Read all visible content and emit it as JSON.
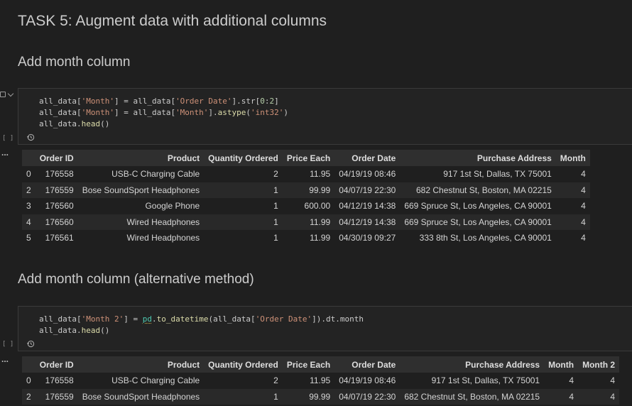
{
  "headings": {
    "task": "TASK 5: Augment data with additional columns",
    "section1": "Add month column",
    "section2": "Add month column (alternative method)"
  },
  "cells": [
    {
      "exec_count": "[ ]",
      "code_lines": [
        "all_data['Month'] = all_data['Order Date'].str[0:2]",
        "all_data['Month'] = all_data['Month'].astype('int32')",
        "all_data.head()"
      ]
    },
    {
      "exec_count": "[ ]",
      "code_lines": [
        "all_data['Month 2'] = pd.to_datetime(all_data['Order Date']).dt.month",
        "all_data.head()"
      ]
    }
  ],
  "output_marker": "...",
  "table1": {
    "columns": [
      "",
      "Order ID",
      "Product",
      "Quantity Ordered",
      "Price Each",
      "Order Date",
      "Purchase Address",
      "Month"
    ],
    "rows": [
      [
        "0",
        "176558",
        "USB-C Charging Cable",
        "2",
        "11.95",
        "04/19/19 08:46",
        "917 1st St, Dallas, TX 75001",
        "4"
      ],
      [
        "2",
        "176559",
        "Bose SoundSport Headphones",
        "1",
        "99.99",
        "04/07/19 22:30",
        "682 Chestnut St, Boston, MA 02215",
        "4"
      ],
      [
        "3",
        "176560",
        "Google Phone",
        "1",
        "600.00",
        "04/12/19 14:38",
        "669 Spruce St, Los Angeles, CA 90001",
        "4"
      ],
      [
        "4",
        "176560",
        "Wired Headphones",
        "1",
        "11.99",
        "04/12/19 14:38",
        "669 Spruce St, Los Angeles, CA 90001",
        "4"
      ],
      [
        "5",
        "176561",
        "Wired Headphones",
        "1",
        "11.99",
        "04/30/19 09:27",
        "333 8th St, Los Angeles, CA 90001",
        "4"
      ]
    ]
  },
  "table2": {
    "columns": [
      "",
      "Order ID",
      "Product",
      "Quantity Ordered",
      "Price Each",
      "Order Date",
      "Purchase Address",
      "Month",
      "Month 2"
    ],
    "rows": [
      [
        "0",
        "176558",
        "USB-C Charging Cable",
        "2",
        "11.95",
        "04/19/19 08:46",
        "917 1st St, Dallas, TX 75001",
        "4",
        "4"
      ],
      [
        "2",
        "176559",
        "Bose SoundSport Headphones",
        "1",
        "99.99",
        "04/07/19 22:30",
        "682 Chestnut St, Boston, MA 02215",
        "4",
        "4"
      ]
    ]
  },
  "icons": {
    "cell_toggle": "square-chevron-icon",
    "history": "history-icon"
  },
  "colors": {
    "background": "#1f1f1f",
    "cell_background": "#232323",
    "string": "#ce9178",
    "number": "#b5cea8",
    "function": "#dcdcaa"
  }
}
